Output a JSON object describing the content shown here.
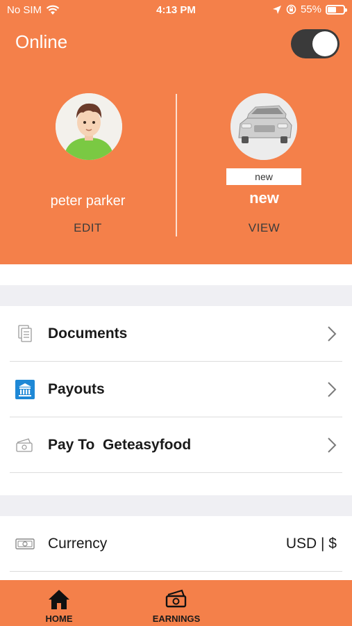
{
  "status_bar": {
    "carrier": "No SIM",
    "time": "4:13 PM",
    "battery": "55%",
    "battery_level": 0.55
  },
  "header": {
    "title": "Online",
    "online_toggle_on": true,
    "colors": {
      "accent": "#f4804a",
      "toggle_track": "#3a3a3a"
    }
  },
  "profile": {
    "name": "peter parker",
    "edit_label": "EDIT",
    "avatar_icon": "user-avatar-icon"
  },
  "vehicle": {
    "badge": "new",
    "name": "new",
    "view_label": "VIEW",
    "avatar_icon": "car-avatar-icon"
  },
  "menu": {
    "items": [
      {
        "label": "Documents",
        "icon": "documents-icon"
      },
      {
        "label": "Payouts",
        "icon": "bank-icon"
      },
      {
        "label": "Pay To  Geteasyfood",
        "icon": "cash-icon"
      }
    ]
  },
  "settings": {
    "currency_label": "Currency",
    "currency_value": "USD | $",
    "icon": "money-icon"
  },
  "tabbar": {
    "tabs": [
      {
        "label": "HOME",
        "icon": "home-icon"
      },
      {
        "label": "EARNINGS",
        "icon": "earnings-icon"
      }
    ]
  }
}
